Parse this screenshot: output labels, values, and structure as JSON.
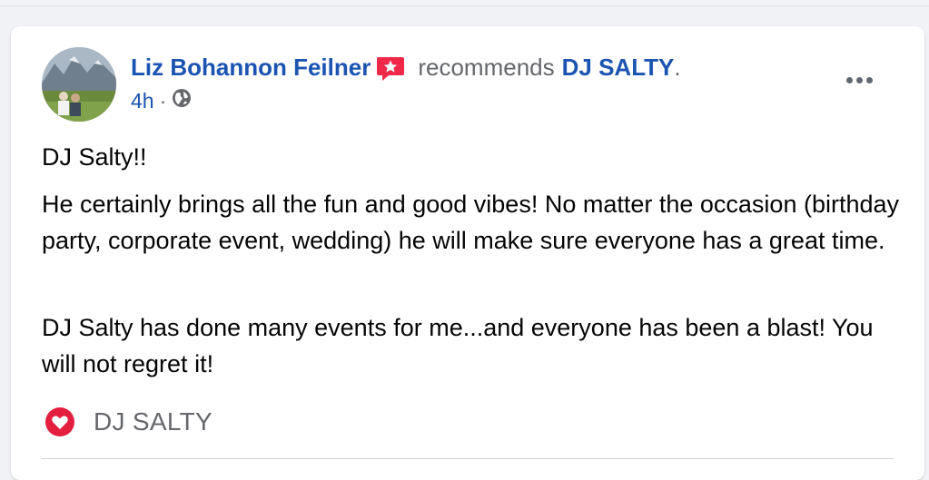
{
  "post": {
    "author_name": "Liz Bohannon Feilner",
    "action_text": "recommends",
    "page_name": "DJ SALTY",
    "page_suffix": ".",
    "timestamp": "4h",
    "separator": "·",
    "privacy_icon": "globe-icon",
    "badge_icon": "recommendation-badge-icon",
    "more_icon": "more-options-icon",
    "paragraphs": [
      "DJ Salty!!",
      "He certainly brings all the fun and good vibes! No matter the occasion (birthday party, corporate event, wedding) he will make sure everyone has a great time.",
      "DJ Salty has done many events for me...and everyone has been a blast! You will not regret it!"
    ],
    "page_tag": {
      "icon": "heart-icon",
      "label": "DJ SALTY"
    }
  },
  "colors": {
    "link_blue": "#1c54b2",
    "meta_gray": "#65676b",
    "heart_red": "#e41e3f",
    "badge_red": "#f02849"
  }
}
